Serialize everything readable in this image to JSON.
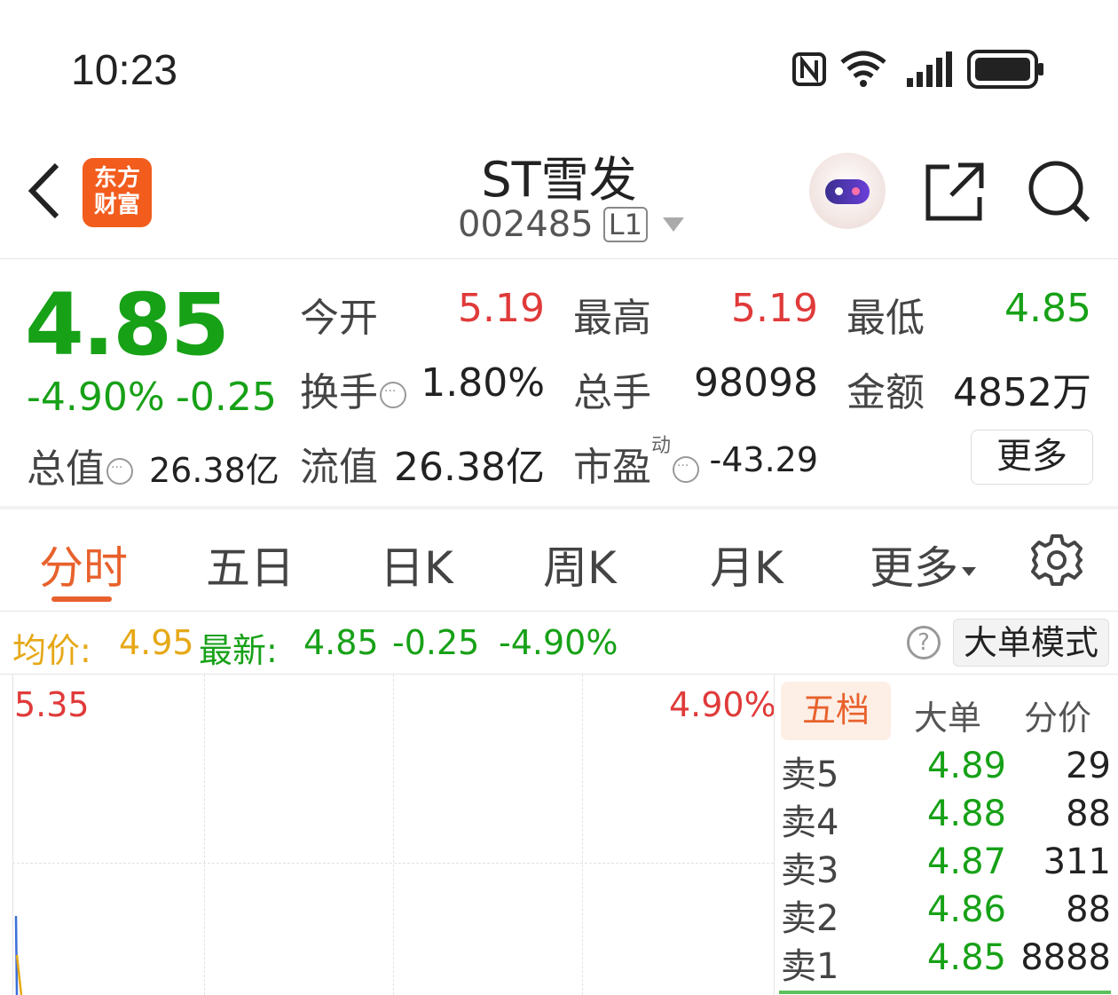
{
  "status_bar": {
    "time": "10:23",
    "icons": [
      "nfc-icon",
      "wifi-icon",
      "signal-icon",
      "battery-icon"
    ]
  },
  "header": {
    "app_logo_line1": "东方",
    "app_logo_line2": "财富",
    "stock_name": "ST雪发",
    "stock_code": "002485",
    "level_badge": "L1"
  },
  "quote": {
    "price": "4.85",
    "change_pct": "-4.90%",
    "change_amt": "-0.25",
    "open_label": "今开",
    "open_value": "5.19",
    "high_label": "最高",
    "high_value": "5.19",
    "low_label": "最低",
    "low_value": "4.85",
    "turnover_label": "换手",
    "turnover_value": "1.80%",
    "volume_label": "总手",
    "volume_value": "98098",
    "amount_label": "金额",
    "amount_value": "4852万",
    "total_cap_label": "总值",
    "total_cap_value": "26.38亿",
    "float_cap_label": "流值",
    "float_cap_value": "26.38亿",
    "pe_label": "市盈",
    "pe_sup": "动",
    "pe_value": "-43.29",
    "more_button": "更多"
  },
  "tabs": {
    "items": [
      "分时",
      "五日",
      "日K",
      "周K",
      "月K",
      "更多"
    ],
    "active": "分时"
  },
  "info_line": {
    "avg_label": "均价:",
    "avg_value": "4.95",
    "latest_label": "最新:",
    "latest_value": "4.85",
    "latest_change": "-0.25",
    "latest_pct": "-4.90%",
    "mode_button": "大单模式"
  },
  "chart": {
    "top_price": "5.35",
    "top_pct": "4.90%"
  },
  "order_book": {
    "tabs": [
      "五档",
      "大单",
      "分价"
    ],
    "active_tab": "五档",
    "asks": [
      {
        "label": "卖5",
        "price": "4.89",
        "volume": "29"
      },
      {
        "label": "卖4",
        "price": "4.88",
        "volume": "88"
      },
      {
        "label": "卖3",
        "price": "4.87",
        "volume": "311"
      },
      {
        "label": "卖2",
        "price": "4.86",
        "volume": "88"
      },
      {
        "label": "卖1",
        "price": "4.85",
        "volume": "8888"
      }
    ]
  },
  "colors": {
    "up": "#e03a3a",
    "down": "#17a117",
    "accent": "#e8612c",
    "avg": "#e6a817"
  }
}
